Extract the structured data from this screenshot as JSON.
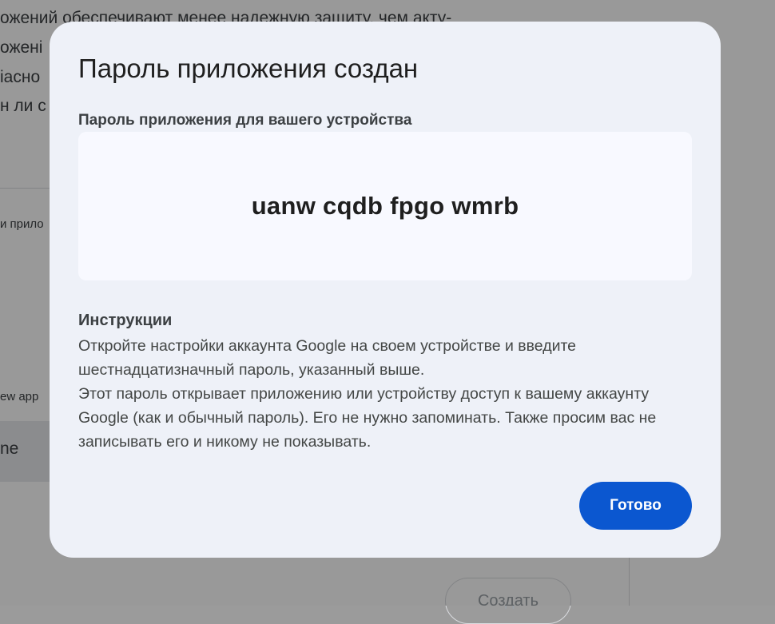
{
  "background": {
    "lines": [
      "ожений обеспечивают менее надежную защиту, чем акту-",
      "оженi",
      "іасно",
      "н ли с"
    ],
    "label_app": "и прило",
    "label_new_app": "ew app",
    "field_value": "ne",
    "create_button": "Создать"
  },
  "dialog": {
    "title": "Пароль приложения создан",
    "subtitle": "Пароль приложения для вашего устройства",
    "password": "uanw cqdb fpgo wmrb",
    "instructions_heading": "Инструкции",
    "instructions_p1": "Откройте настройки аккаунта Google на своем устройстве и введите шестнадцатизначный пароль, указанный выше.",
    "instructions_p2": "Этот пароль открывает приложению или устройству доступ к вашему аккаунту Google (как и обычный пароль). Его не нужно запоминать. Также просим вас не записывать его и никому не показывать.",
    "done_label": "Готово"
  },
  "colors": {
    "accent": "#0b57d0",
    "dialog_bg": "#eef1f8",
    "password_box_bg": "#f8f9ff"
  }
}
